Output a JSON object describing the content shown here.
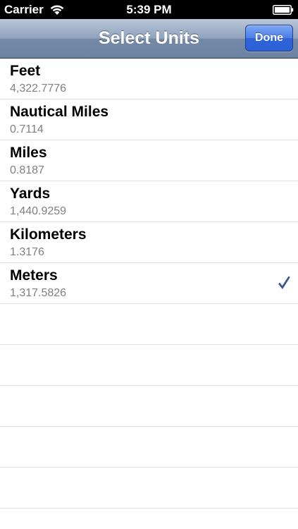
{
  "status_bar": {
    "carrier": "Carrier",
    "time": "5:39 PM",
    "icons": [
      "wifi-icon",
      "battery-icon"
    ]
  },
  "nav_bar": {
    "title": "Select Units",
    "done_label": "Done"
  },
  "units": [
    {
      "name": "Feet",
      "value": "4,322.7776",
      "selected": false
    },
    {
      "name": "Nautical Miles",
      "value": "0.7114",
      "selected": false
    },
    {
      "name": "Miles",
      "value": "0.8187",
      "selected": false
    },
    {
      "name": "Yards",
      "value": "1,440.9259",
      "selected": false
    },
    {
      "name": "Kilometers",
      "value": "1.3176",
      "selected": false
    },
    {
      "name": "Meters",
      "value": "1,317.5826",
      "selected": true
    }
  ],
  "colors": {
    "checkmark": "#3a5795",
    "done_button": "#2e63d9"
  }
}
